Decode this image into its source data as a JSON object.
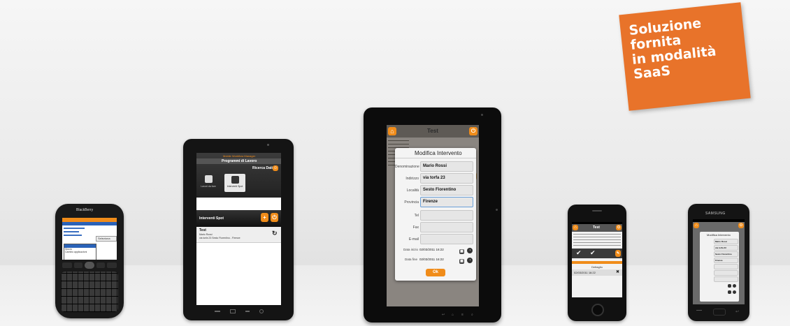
{
  "badge": {
    "lines": [
      "Soluzione",
      "fornita",
      "in modalità",
      "SaaS"
    ],
    "color": "#e8732a"
  },
  "blackberry": {
    "brand": "BlackBerry",
    "screen_lines": [
      "Seleziona",
      "Sincro",
      "Cambio applicazioni"
    ]
  },
  "tablet_left": {
    "app_title": "Mobile Workflow Manager",
    "header": "Programmi di Lavoro",
    "search_label": "Ricerca Dati",
    "tile1": "Lavori da fare",
    "tile2": "Interventi Spot",
    "section_title": "Interventi Spot",
    "item_title": "Test",
    "item_line1": "Mario Rossi",
    "item_line2": "via torfa 23 Sesto Fiorentino - Firenze"
  },
  "tablet_center": {
    "bg_title": "Test",
    "dialog_title": "Modifica Intervento",
    "fields": [
      {
        "label": "Denominazione",
        "value": "Mario Rossi"
      },
      {
        "label": "Indirizzo",
        "value": "via torfa 23"
      },
      {
        "label": "Località",
        "value": "Sesto Fiorentino"
      },
      {
        "label": "Provincia",
        "value": "Firenze"
      },
      {
        "label": "Tel",
        "value": ""
      },
      {
        "label": "Fax",
        "value": ""
      },
      {
        "label": "E-mail",
        "value": ""
      }
    ],
    "date_start_label": "Data inizio",
    "date_start_value": "02/03/2011 16:22",
    "date_end_label": "Data fine",
    "date_end_value": "02/03/2011 16:22",
    "ok_label": "Ok"
  },
  "iphone": {
    "title": "Test",
    "row_label": "Dettaglio",
    "row_value": "02/03/2011 16:22"
  },
  "samsung": {
    "brand": "SAMSUNG",
    "dialog_title": "Modifica Intervento",
    "fields": [
      "Mario Rossi",
      "via torfa 23",
      "Sesto Fiorentino",
      "Firenze"
    ]
  },
  "colors": {
    "accent": "#f08c1a",
    "dark": "#222222"
  }
}
